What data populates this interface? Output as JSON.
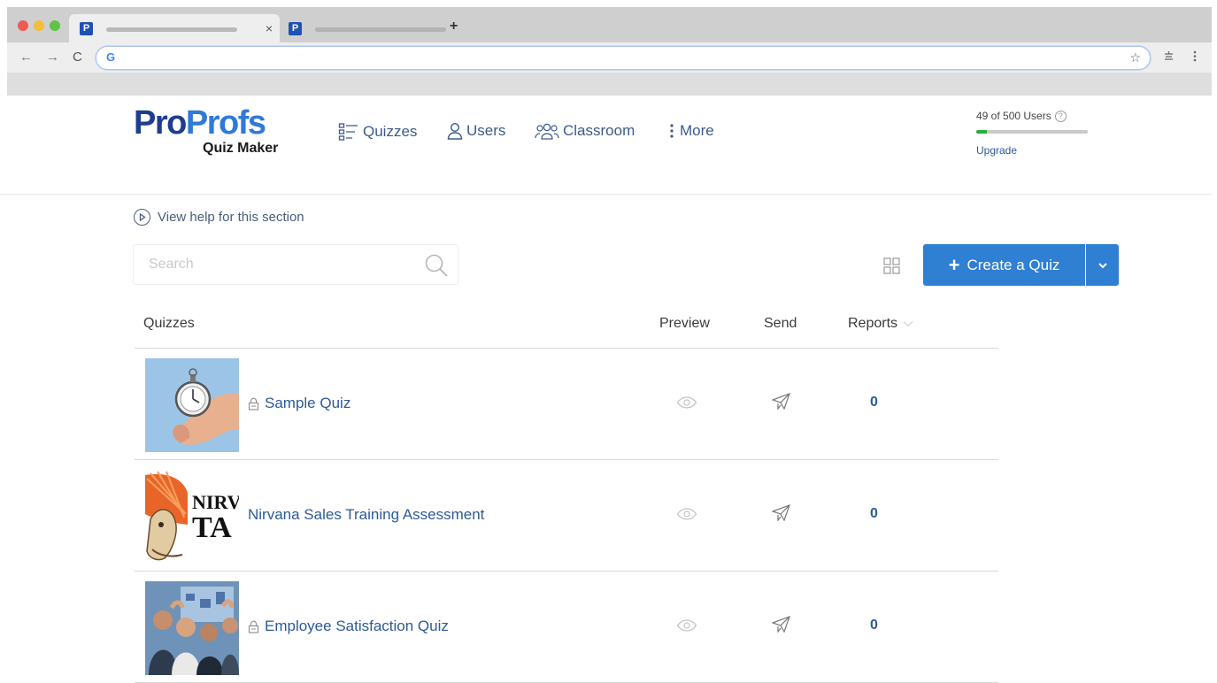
{
  "browser": {
    "tabs": [
      {
        "close": "×"
      },
      {}
    ],
    "new_tab": "+",
    "address_bar_value": ""
  },
  "header": {
    "logo": {
      "pro": "Pro",
      "profs": "Profs",
      "subtitle": "Quiz Maker"
    },
    "nav": [
      {
        "label": "Quizzes",
        "icon": "quizzes-icon"
      },
      {
        "label": "Users",
        "icon": "user-icon"
      },
      {
        "label": "Classroom",
        "icon": "group-icon"
      },
      {
        "label": "More",
        "icon": "kebab-icon"
      }
    ],
    "usage": {
      "text": "49  of  500 Users",
      "used": 49,
      "total": 500,
      "upgrade": "Upgrade"
    }
  },
  "help": {
    "label": "View help for this section"
  },
  "search": {
    "placeholder": "Search",
    "value": ""
  },
  "actions": {
    "create_label": "Create a Quiz",
    "create_icon": "+"
  },
  "table": {
    "columns": {
      "quizzes": "Quizzes",
      "preview": "Preview",
      "send": "Send",
      "reports": "Reports"
    },
    "rows": [
      {
        "name": "Sample Quiz",
        "locked": true,
        "reports": "0",
        "thumb": "stopwatch-image"
      },
      {
        "name": "Nirvana Sales Training Assessment",
        "locked": false,
        "reports": "0",
        "thumb": "nirvana-logo-image"
      },
      {
        "name": "Employee Satisfaction Quiz",
        "locked": true,
        "reports": "0",
        "thumb": "employees-image"
      }
    ]
  },
  "colors": {
    "brand_dark": "#1f3d8f",
    "brand_light": "#2f7ad8",
    "primary_button": "#2f7fd3",
    "link": "#2d5a96",
    "usage_fill": "#2eaa3c"
  }
}
